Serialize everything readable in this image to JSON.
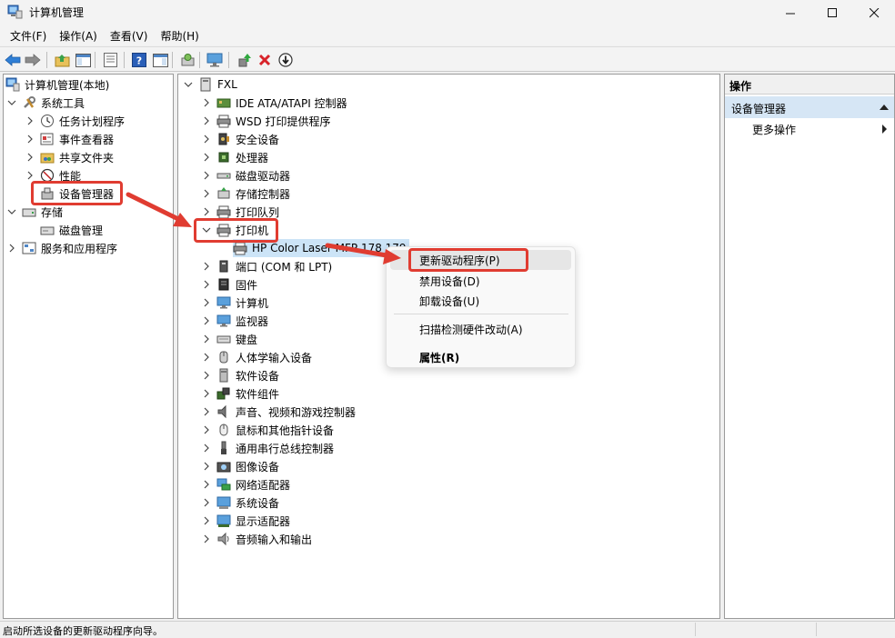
{
  "window": {
    "title": "计算机管理",
    "minimize_icon": "minimize-icon",
    "maximize_icon": "maximize-icon",
    "close_icon": "close-icon"
  },
  "menubar": {
    "items": [
      "文件(F)",
      "操作(A)",
      "查看(V)",
      "帮助(H)"
    ]
  },
  "toolbar": {
    "icons": [
      "back-icon",
      "forward-icon",
      "up-folder-icon",
      "show-hide-tree-icon",
      "properties-icon",
      "help-icon",
      "show-hide-action-icon",
      "scan-hardware-icon",
      "computer-monitor-icon",
      "update-driver-icon",
      "uninstall-icon",
      "disable-icon"
    ]
  },
  "left_tree": {
    "root": "计算机管理(本地)",
    "system_tools": "系统工具",
    "task_scheduler": "任务计划程序",
    "event_viewer": "事件查看器",
    "shared_folders": "共享文件夹",
    "performance": "性能",
    "device_manager": "设备管理器",
    "storage": "存储",
    "disk_management": "磁盘管理",
    "services_apps": "服务和应用程序"
  },
  "device_tree": {
    "root": "FXL",
    "categories": [
      "IDE ATA/ATAPI 控制器",
      "WSD 打印提供程序",
      "安全设备",
      "处理器",
      "磁盘驱动器",
      "存储控制器",
      "打印队列",
      "打印机"
    ],
    "printer_child": "HP Color Laser MFP 178 179",
    "categories_after": [
      "端口 (COM 和 LPT)",
      "固件",
      "计算机",
      "监视器",
      "键盘",
      "人体学输入设备",
      "软件设备",
      "软件组件",
      "声音、视频和游戏控制器",
      "鼠标和其他指针设备",
      "通用串行总线控制器",
      "图像设备",
      "网络适配器",
      "系统设备",
      "显示适配器",
      "音频输入和输出"
    ]
  },
  "context_menu": {
    "update_driver": "更新驱动程序(P)",
    "disable_device": "禁用设备(D)",
    "uninstall_device": "卸载设备(U)",
    "scan_hardware": "扫描检测硬件改动(A)",
    "properties": "属性(R)"
  },
  "actions_pane": {
    "header": "操作",
    "section": "设备管理器",
    "more_actions": "更多操作"
  },
  "status_bar": {
    "text": "启动所选设备的更新驱动程序向导。"
  },
  "colors": {
    "annotation_red": "#e03c31",
    "selection_blue": "#cce4f7",
    "section_blue": "#d6e6f5"
  }
}
